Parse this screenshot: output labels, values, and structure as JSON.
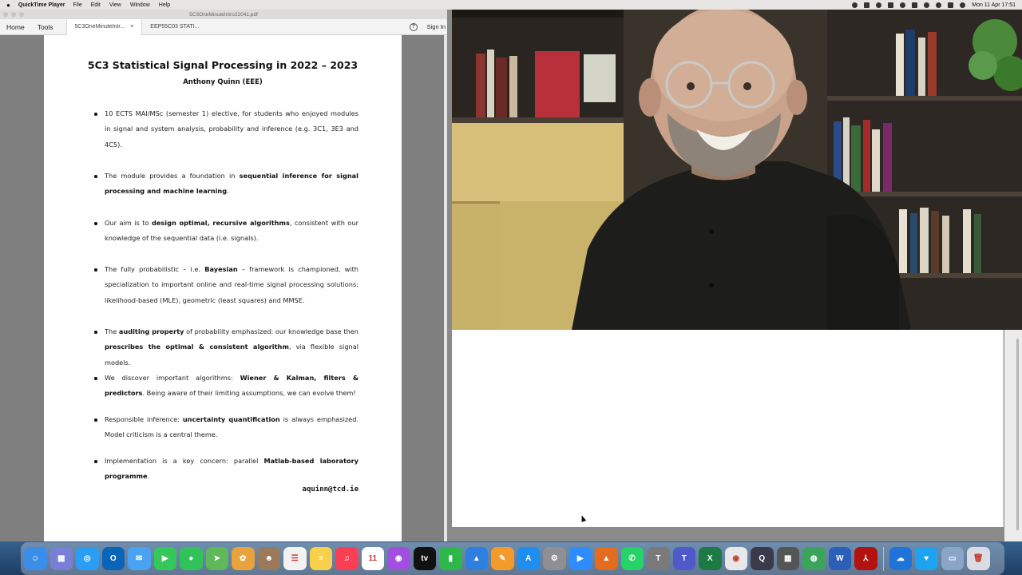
{
  "menubar": {
    "app_name": "QuickTime Player",
    "menus": [
      "File",
      "Edit",
      "View",
      "Window",
      "Help"
    ],
    "clock": "Mon 11 Apr  17:51"
  },
  "acrobat": {
    "window_title": "5C3OneMinuteIntro22041.pdf",
    "nav": {
      "home": "Home",
      "tools": "Tools"
    },
    "tabs": [
      {
        "label": "5C3OneMinuteIntr...",
        "close": "×"
      },
      {
        "label": "EEP55C03 STATI..."
      }
    ],
    "help_glyph": "?",
    "sign_in": "Sign In"
  },
  "document": {
    "title": "5C3 Statistical Signal Processing in 2022 – 2023",
    "author": "Anthony Quinn (EEE)",
    "email": "aquinn@tcd.ie",
    "bullets": [
      {
        "parts": [
          {
            "t": "10 ECTS MAI/MSc (semester 1) elective, for students who enjoyed modules in signal and system analysis, probability and inference (e.g. 3C1, 3E3 and 4C5)."
          }
        ]
      },
      {
        "parts": [
          {
            "t": "The module provides a foundation in "
          },
          {
            "t": "sequential inference for signal processing and machine learning",
            "b": true
          },
          {
            "t": "."
          }
        ]
      },
      {
        "parts": [
          {
            "t": "Our aim is to "
          },
          {
            "t": "design optimal, recursive algorithms",
            "b": true
          },
          {
            "t": ", consistent with our knowledge of the sequential data (i.e. signals)."
          }
        ]
      },
      {
        "parts": [
          {
            "t": "The fully probabilistic – i.e. "
          },
          {
            "t": "Bayesian",
            "b": true
          },
          {
            "t": " – framework is championed, with specialization to important online and real-time signal processing solutions: likelihood-based (MLE), geometric (least squares) and MMSE."
          }
        ]
      },
      {
        "parts": [
          {
            "t": "The "
          },
          {
            "t": "auditing property",
            "b": true
          },
          {
            "t": " of probability emphasized: our knowledge base then "
          },
          {
            "t": "prescribes the optimal & consistent algorithm",
            "b": true
          },
          {
            "t": ", via flexible signal models."
          }
        ]
      },
      {
        "parts": [
          {
            "t": "We discover important algorithms: "
          },
          {
            "t": "Wiener & Kalman, filters & predictors",
            "b": true
          },
          {
            "t": ". Being aware of their limiting assumptions, we can evolve them!"
          }
        ]
      },
      {
        "parts": [
          {
            "t": "Responsible inference: "
          },
          {
            "t": "uncertainty quantification",
            "b": true
          },
          {
            "t": " is always emphasized. Model criticism is a central theme."
          }
        ]
      },
      {
        "parts": [
          {
            "t": "Implementation is a key concern: parallel "
          },
          {
            "t": "Matlab-based laboratory programme",
            "b": true
          },
          {
            "t": "."
          }
        ]
      }
    ]
  },
  "dock": {
    "apps": [
      {
        "name": "finder-icon",
        "color": "#3b8ee8",
        "glyph": "☺"
      },
      {
        "name": "launchpad-icon",
        "color": "#7a7fd6",
        "glyph": "▦"
      },
      {
        "name": "safari-icon",
        "color": "#2a9df4",
        "glyph": "◎"
      },
      {
        "name": "outlook-icon",
        "color": "#0a64b8",
        "glyph": "O"
      },
      {
        "name": "mail-icon",
        "color": "#4aa3f0",
        "glyph": "✉"
      },
      {
        "name": "facetime-icon",
        "color": "#34c759",
        "glyph": "▶"
      },
      {
        "name": "messages-icon",
        "color": "#32c25a",
        "glyph": "●"
      },
      {
        "name": "maps-icon",
        "color": "#5fb85a",
        "glyph": "➤"
      },
      {
        "name": "photos-icon",
        "color": "#e8a33c",
        "glyph": "✿"
      },
      {
        "name": "contacts-icon",
        "color": "#9a7a5a",
        "glyph": "☻"
      },
      {
        "name": "reminders-icon",
        "color": "#f2f2f2",
        "glyph": "☰"
      },
      {
        "name": "notes-icon",
        "color": "#f7d14a",
        "glyph": "≡"
      },
      {
        "name": "music-icon",
        "color": "#fa3f55",
        "glyph": "♫"
      },
      {
        "name": "calendar-icon",
        "color": "#ffffff",
        "glyph": "11"
      },
      {
        "name": "podcasts-icon",
        "color": "#a24ee0",
        "glyph": "◉"
      },
      {
        "name": "apple-tv-icon",
        "color": "#111111",
        "glyph": "tv"
      },
      {
        "name": "numbers-icon",
        "color": "#2fb84a",
        "glyph": "▮"
      },
      {
        "name": "keynote-icon",
        "color": "#2f7fe0",
        "glyph": "▲"
      },
      {
        "name": "pages-icon",
        "color": "#f39a2b",
        "glyph": "✎"
      },
      {
        "name": "app-store-icon",
        "color": "#1e8ef0",
        "glyph": "A"
      },
      {
        "name": "system-preferences-icon",
        "color": "#8e8e93",
        "glyph": "⚙"
      },
      {
        "name": "zoom-icon",
        "color": "#2d8cff",
        "glyph": "▶"
      },
      {
        "name": "matlab-icon",
        "color": "#e36c1f",
        "glyph": "▲"
      },
      {
        "name": "whatsapp-icon",
        "color": "#25d366",
        "glyph": "✆"
      },
      {
        "name": "tex-icon",
        "color": "#7a7a7a",
        "glyph": "T"
      },
      {
        "name": "teams-icon",
        "color": "#5059c9",
        "glyph": "T"
      },
      {
        "name": "excel-icon",
        "color": "#1d7a45",
        "glyph": "X"
      },
      {
        "name": "chrome-icon",
        "color": "#e8e8e8",
        "glyph": "◉"
      },
      {
        "name": "quicktime-icon",
        "color": "#3a3a4a",
        "glyph": "Q"
      },
      {
        "name": "calculator-icon",
        "color": "#555555",
        "glyph": "▦"
      },
      {
        "name": "network-icon",
        "color": "#3aa55a",
        "glyph": "◍"
      },
      {
        "name": "word-icon",
        "color": "#2b5fb8",
        "glyph": "W"
      },
      {
        "name": "acrobat-icon",
        "color": "#b3120f",
        "glyph": "⅄"
      }
    ],
    "extras": [
      {
        "name": "onedrive-icon",
        "color": "#1f73d9",
        "glyph": "☁"
      },
      {
        "name": "heart-app-icon",
        "color": "#1ea3f0",
        "glyph": "♥"
      },
      {
        "name": "desktop-folder-icon",
        "color": "#8aa5c8",
        "glyph": "▭"
      },
      {
        "name": "trash-icon",
        "color": "#d9dde3",
        "glyph": "🗑"
      }
    ]
  }
}
